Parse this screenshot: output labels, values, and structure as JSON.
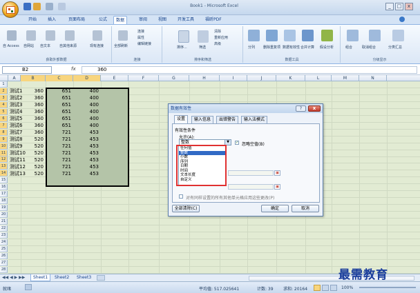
{
  "window": {
    "title": "Book1 - Microsoft Excel",
    "min": "_",
    "max": "□",
    "close": "x"
  },
  "tabs": [
    "开始",
    "插入",
    "页面布局",
    "公式",
    "数据",
    "审阅",
    "视图",
    "开发工具",
    "福昕PDF"
  ],
  "ribbon": {
    "groups": [
      {
        "label": "获取外部数据",
        "items": [
          "自 Access",
          "自网站",
          "自文本",
          "自其他来源",
          "现有连接"
        ]
      },
      {
        "label": "连接",
        "items": [
          "全部刷新",
          "连接",
          "属性",
          "编辑链接"
        ]
      },
      {
        "label": "排序和筛选",
        "items": [
          "排序...",
          "筛选",
          "清除",
          "重新应用",
          "高级"
        ]
      },
      {
        "label": "数据工具",
        "items": [
          "分列",
          "删除重复项",
          "数据有效性",
          "合并计算",
          "假设分析"
        ]
      },
      {
        "label": "分级显示",
        "items": [
          "组合",
          "取消组合",
          "分类汇总"
        ]
      }
    ]
  },
  "formula": {
    "namebox": "B2",
    "fx": "fx",
    "value": "360"
  },
  "columns": [
    "A",
    "B",
    "C",
    "D",
    "E",
    "F",
    "G",
    "H",
    "I",
    "J",
    "K",
    "L",
    "M",
    "N"
  ],
  "rows": [
    "1",
    "2",
    "3",
    "4",
    "5",
    "6",
    "7",
    "8",
    "9",
    "10",
    "11",
    "12",
    "13",
    "14",
    "15",
    "16",
    "17",
    "18",
    "19",
    "20",
    "21",
    "22",
    "23",
    "24",
    "25",
    "26",
    "27",
    "28"
  ],
  "cells": [
    [
      "测试1",
      "360",
      "651",
      "400"
    ],
    [
      "测试2",
      "360",
      "651",
      "400"
    ],
    [
      "测试3",
      "360",
      "651",
      "400"
    ],
    [
      "测试4",
      "360",
      "651",
      "400"
    ],
    [
      "测试5",
      "360",
      "651",
      "400"
    ],
    [
      "测试6",
      "360",
      "651",
      "400"
    ],
    [
      "测试7",
      "360",
      "721",
      "453"
    ],
    [
      "测试8",
      "520",
      "721",
      "453"
    ],
    [
      "测试9",
      "520",
      "721",
      "453"
    ],
    [
      "测试10",
      "520",
      "721",
      "453"
    ],
    [
      "测试11",
      "520",
      "721",
      "453"
    ],
    [
      "测试12",
      "520",
      "721",
      "453"
    ],
    [
      "测试13",
      "520",
      "721",
      "453"
    ]
  ],
  "dialog": {
    "title": "数据有效性",
    "help": "?",
    "close": "x",
    "tabs": [
      "设置",
      "输入信息",
      "出错警告",
      "输入法模式"
    ],
    "criteria_label": "有效性条件",
    "allow_label": "允许(A):",
    "allow_value": "整数",
    "ignore_blank": "忽略空值(B)",
    "dropdown": [
      "任何值",
      "整数",
      "小数",
      "序列",
      "日期",
      "时间",
      "文本长度",
      "自定义"
    ],
    "apply_all": "对有同样设置的所有其他单元格应用这些更改(P)",
    "clear_all": "全部清除(C)",
    "ok": "确定",
    "cancel": "取消"
  },
  "sheets": [
    "Sheet1",
    "Sheet2",
    "Sheet3"
  ],
  "status": {
    "mode": "就绪",
    "average": "平均值: 517.025641",
    "count": "计数: 39",
    "sum": "求和: 20164",
    "zoom": "100%"
  },
  "watermark": "最需教育"
}
